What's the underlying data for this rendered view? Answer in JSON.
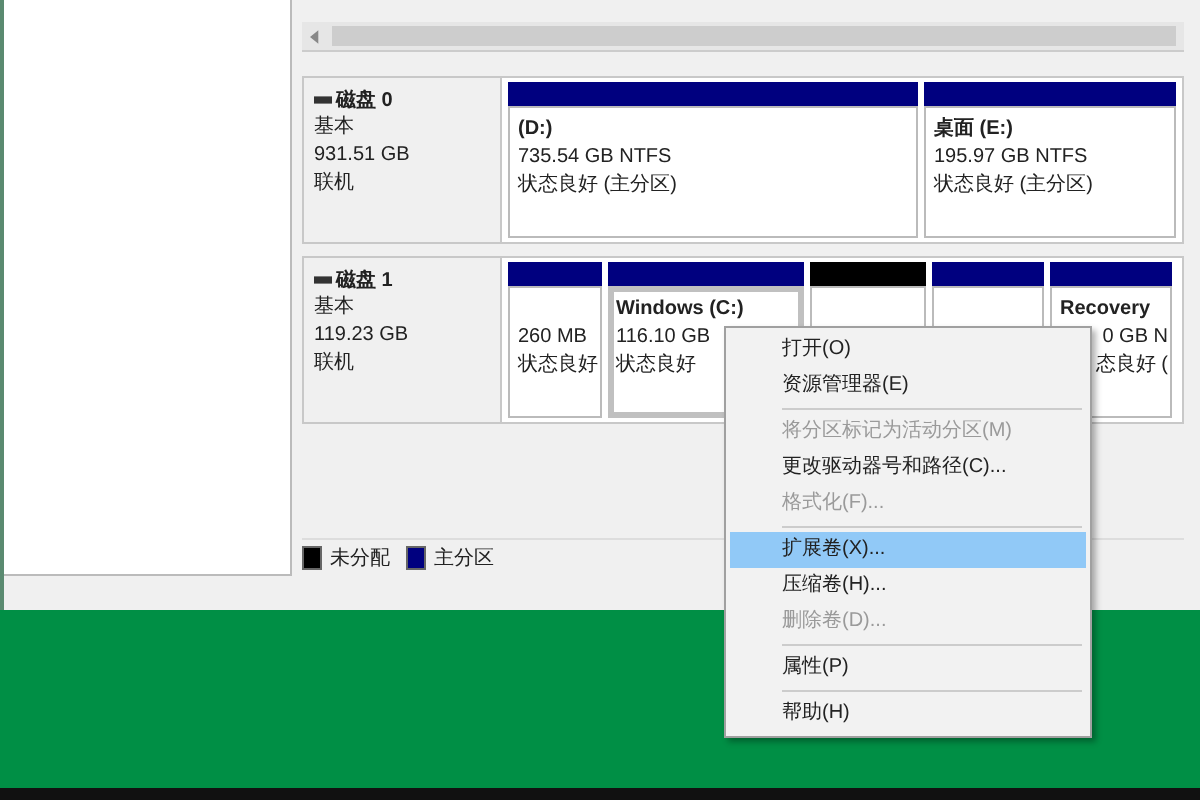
{
  "disks": [
    {
      "name": "磁盘 0",
      "type": "基本",
      "size": "931.51 GB",
      "status": "联机",
      "partitions": [
        {
          "color": "#00007f",
          "selected": false,
          "label": "(D:)",
          "details": [
            "735.54 GB NTFS",
            "状态良好 (主分区)"
          ]
        },
        {
          "color": "#00007f",
          "selected": false,
          "label": "桌面  (E:)",
          "details": [
            "195.97 GB NTFS",
            "状态良好 (主分区)"
          ]
        }
      ]
    },
    {
      "name": "磁盘 1",
      "type": "基本",
      "size": "119.23 GB",
      "status": "联机",
      "partitions": [
        {
          "color": "#00007f",
          "selected": false,
          "details": [
            "260 MB",
            "状态良好"
          ]
        },
        {
          "color": "#00007f",
          "selected": true,
          "label": "Windows  (C:)",
          "details": [
            "116.10 GB",
            "状态良好"
          ]
        },
        {
          "color": "#000000",
          "selected": false
        },
        {
          "color": "#00007f",
          "selected": false
        },
        {
          "color": "#00007f",
          "selected": false,
          "label": "Recovery",
          "details": [
            "0 GB N",
            "态良好 ("
          ]
        }
      ]
    }
  ],
  "legend": [
    {
      "label": "未分配",
      "color": "#000000"
    },
    {
      "label": "主分区",
      "color": "#00007f"
    }
  ],
  "context_menu": [
    {
      "kind": "item",
      "label": "打开(O)",
      "disabled": false,
      "selected": false
    },
    {
      "kind": "item",
      "label": "资源管理器(E)",
      "disabled": false,
      "selected": false
    },
    {
      "kind": "separator"
    },
    {
      "kind": "item",
      "label": "将分区标记为活动分区(M)",
      "disabled": true,
      "selected": false
    },
    {
      "kind": "item",
      "label": "更改驱动器号和路径(C)...",
      "disabled": false,
      "selected": false
    },
    {
      "kind": "item",
      "label": "格式化(F)...",
      "disabled": true,
      "selected": false
    },
    {
      "kind": "separator"
    },
    {
      "kind": "item",
      "label": "扩展卷(X)...",
      "disabled": false,
      "selected": true
    },
    {
      "kind": "item",
      "label": "压缩卷(H)...",
      "disabled": false,
      "selected": false
    },
    {
      "kind": "item",
      "label": "删除卷(D)...",
      "disabled": true,
      "selected": false
    },
    {
      "kind": "separator"
    },
    {
      "kind": "item",
      "label": "属性(P)",
      "disabled": false,
      "selected": false
    },
    {
      "kind": "separator"
    },
    {
      "kind": "item",
      "label": "帮助(H)",
      "disabled": false,
      "selected": false
    }
  ]
}
